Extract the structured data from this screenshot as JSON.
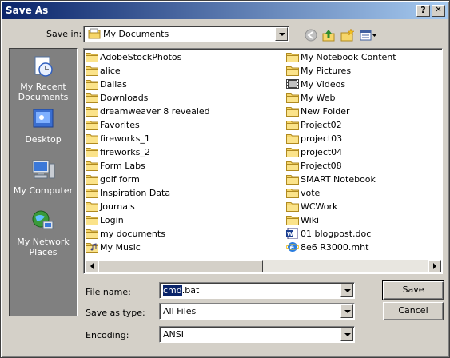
{
  "window": {
    "title": "Save As"
  },
  "titlebar": {
    "help_label": "?",
    "close_label": "✕"
  },
  "save_in": {
    "label": "Save in:",
    "value": "My Documents"
  },
  "toolbar": {
    "back_icon": "back-arrow-icon",
    "up_icon": "up-folder-icon",
    "new_folder_icon": "new-folder-icon",
    "views_icon": "views-menu-icon"
  },
  "places": [
    {
      "label": "My Recent Documents",
      "icon": "recent-documents-icon"
    },
    {
      "label": "Desktop",
      "icon": "desktop-icon"
    },
    {
      "label": "My Computer",
      "icon": "my-computer-icon"
    },
    {
      "label": "My Network Places",
      "icon": "network-places-icon"
    }
  ],
  "files_col1": [
    {
      "name": "AdobeStockPhotos",
      "type": "folder"
    },
    {
      "name": "alice",
      "type": "folder"
    },
    {
      "name": "Dallas",
      "type": "folder"
    },
    {
      "name": "Downloads",
      "type": "folder"
    },
    {
      "name": "dreamweaver 8 revealed",
      "type": "folder"
    },
    {
      "name": "Favorites",
      "type": "folder"
    },
    {
      "name": "fireworks_1",
      "type": "folder"
    },
    {
      "name": "fireworks_2",
      "type": "folder"
    },
    {
      "name": "Form Labs",
      "type": "folder"
    },
    {
      "name": "golf form",
      "type": "folder"
    },
    {
      "name": "Inspiration Data",
      "type": "folder"
    },
    {
      "name": "Journals",
      "type": "folder"
    },
    {
      "name": "Login",
      "type": "folder"
    },
    {
      "name": "my documents",
      "type": "folder"
    },
    {
      "name": "My Music",
      "type": "music-folder"
    }
  ],
  "files_col2": [
    {
      "name": "My Notebook Content",
      "type": "folder"
    },
    {
      "name": "My Pictures",
      "type": "folder"
    },
    {
      "name": "My Videos",
      "type": "video-folder"
    },
    {
      "name": "My Web",
      "type": "folder"
    },
    {
      "name": "New Folder",
      "type": "folder"
    },
    {
      "name": "Project02",
      "type": "folder"
    },
    {
      "name": "project03",
      "type": "folder"
    },
    {
      "name": "project04",
      "type": "folder"
    },
    {
      "name": "Project08",
      "type": "folder"
    },
    {
      "name": "SMART Notebook",
      "type": "folder"
    },
    {
      "name": "vote",
      "type": "folder"
    },
    {
      "name": "WCWork",
      "type": "folder"
    },
    {
      "name": "Wiki",
      "type": "folder"
    },
    {
      "name": "01 blogpost.doc",
      "type": "word-doc"
    },
    {
      "name": "8e6 R3000.mht",
      "type": "ie-document"
    }
  ],
  "form": {
    "file_name_label": "File name:",
    "file_name_selected": "cmd",
    "file_name_rest": ".bat",
    "save_as_type_label": "Save as type:",
    "save_as_type_value": "All Files",
    "encoding_label": "Encoding:",
    "encoding_value": "ANSI"
  },
  "buttons": {
    "save": "Save",
    "cancel": "Cancel"
  },
  "colors": {
    "title_start": "#0a246a",
    "title_end": "#a6caf0",
    "face": "#d4d0c8",
    "folder": "#f6d66a"
  }
}
